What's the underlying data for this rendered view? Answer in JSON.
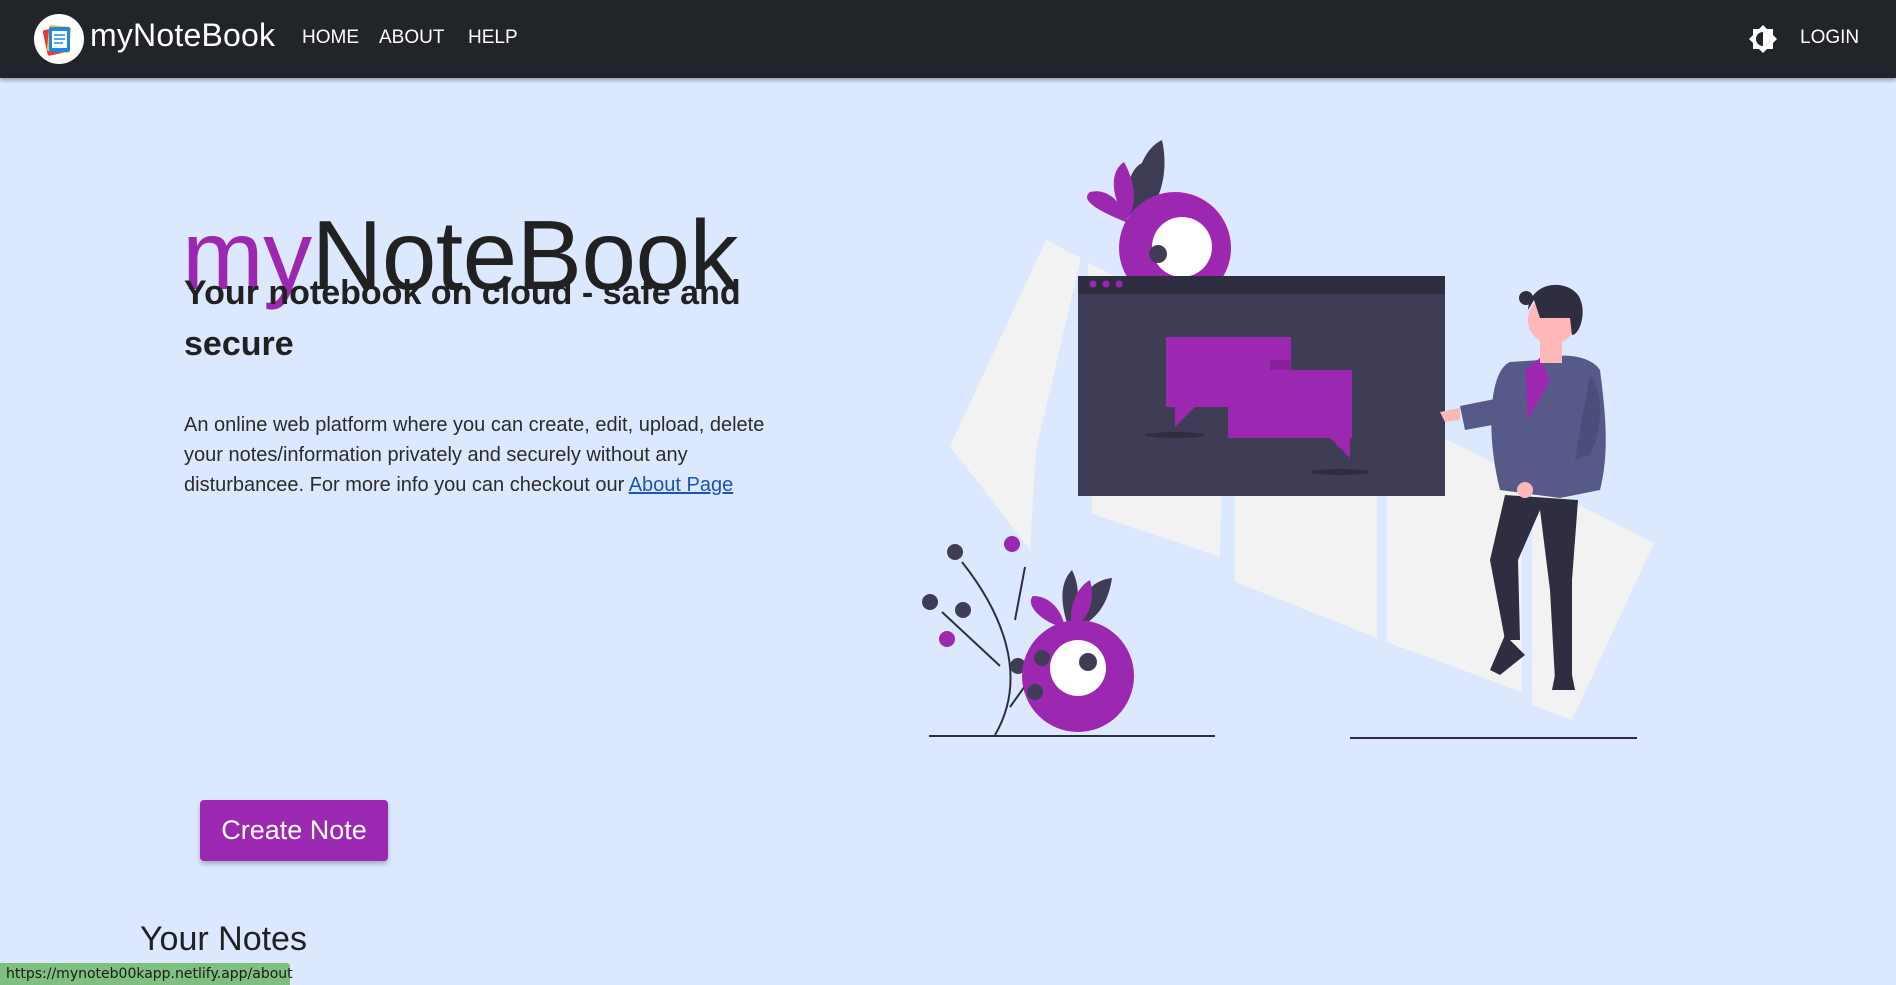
{
  "navbar": {
    "brand": "myNoteBook",
    "links": [
      "HOME",
      "ABOUT",
      "HELP"
    ],
    "login": "LOGIN",
    "icons": {
      "logo": "notebook-logo-icon",
      "theme": "brightness-icon"
    }
  },
  "hero": {
    "title_prefix": "my",
    "title_rest": "NoteBook",
    "subtitle": "Your notebook on cloud - safe and secure",
    "description": "An online web platform where you can create, edit, upload, delete your notes/information privately and securely without any disturbancee. For more info you can checkout our ",
    "link_text": "About Page"
  },
  "actions": {
    "create_note": "Create Note"
  },
  "notes_section": {
    "heading": "Your Notes"
  },
  "status_bar": {
    "url": "https://mynoteb00kapp.netlify.app/about"
  },
  "colors": {
    "accent": "#9c27b0",
    "navbar": "#212529",
    "background": "#dbe8fd"
  }
}
